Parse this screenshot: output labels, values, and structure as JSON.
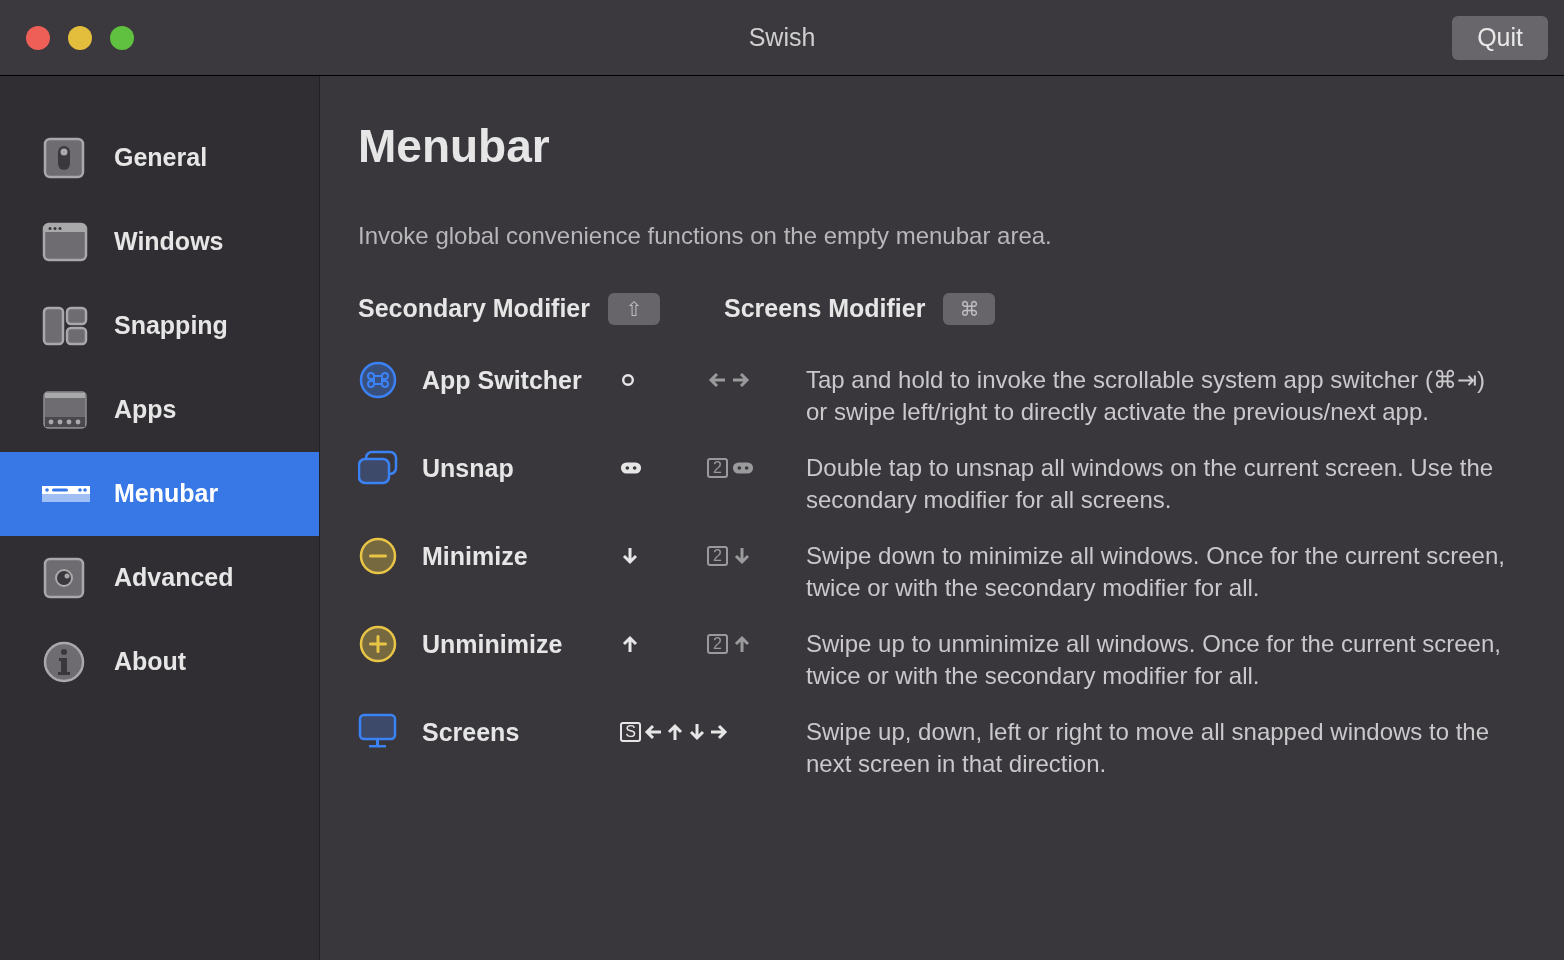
{
  "window": {
    "title": "Swish",
    "quit_button": "Quit"
  },
  "sidebar": {
    "items": [
      {
        "label": "General",
        "kind": "toggle",
        "selected": false
      },
      {
        "label": "Windows",
        "kind": "window",
        "selected": false
      },
      {
        "label": "Snapping",
        "kind": "layout",
        "selected": false
      },
      {
        "label": "Apps",
        "kind": "dock",
        "selected": false
      },
      {
        "label": "Menubar",
        "kind": "menubar",
        "selected": true
      },
      {
        "label": "Advanced",
        "kind": "knob",
        "selected": false
      },
      {
        "label": "About",
        "kind": "info",
        "selected": false
      }
    ]
  },
  "main": {
    "heading": "Menubar",
    "description": "Invoke global convenience functions on the empty menubar area.",
    "modifiers": [
      {
        "label": "Secondary Modifier",
        "key": "⇧"
      },
      {
        "label": "Screens Modifier",
        "key": "⌘"
      }
    ],
    "actions": [
      {
        "label": "App Switcher",
        "kind": "command",
        "color": "#3b82f6",
        "primary": [
          {
            "kind": "circle"
          }
        ],
        "secondary": [
          {
            "kind": "left"
          },
          {
            "kind": "right"
          }
        ],
        "description": "Tap and hold to invoke the scrollable system app switcher (⌘⇥) or swipe left/right to directly activate the previous/next app."
      },
      {
        "label": "Unsnap",
        "kind": "windows",
        "color": "#3b82f6",
        "primary": [
          {
            "kind": "double"
          }
        ],
        "secondary": [
          {
            "kind": "key",
            "text": "2"
          },
          {
            "kind": "double"
          }
        ],
        "description": "Double tap to unsnap all windows on the current screen. Use the secondary modifier for all screens."
      },
      {
        "label": "Minimize",
        "kind": "minus",
        "color": "#e8c547",
        "primary": [
          {
            "kind": "down"
          }
        ],
        "secondary": [
          {
            "kind": "key",
            "text": "2"
          },
          {
            "kind": "down"
          }
        ],
        "description": "Swipe down to minimize all windows. Once for the current screen, twice or with the secondary modifier for all."
      },
      {
        "label": "Unminimize",
        "kind": "plus",
        "color": "#e8c547",
        "primary": [
          {
            "kind": "up"
          }
        ],
        "secondary": [
          {
            "kind": "key",
            "text": "2"
          },
          {
            "kind": "up"
          }
        ],
        "description": "Swipe up to unminimize all windows. Once for the current screen, twice or with the secondary modifier for all."
      },
      {
        "label": "Screens",
        "kind": "display",
        "color": "#3b82f6",
        "primary": [
          {
            "kind": "key",
            "text": "S"
          },
          {
            "kind": "left"
          },
          {
            "kind": "up"
          },
          {
            "kind": "down"
          },
          {
            "kind": "right"
          }
        ],
        "description": "Swipe up, down, left or right to move all snapped windows to the next screen in that direction."
      }
    ]
  }
}
